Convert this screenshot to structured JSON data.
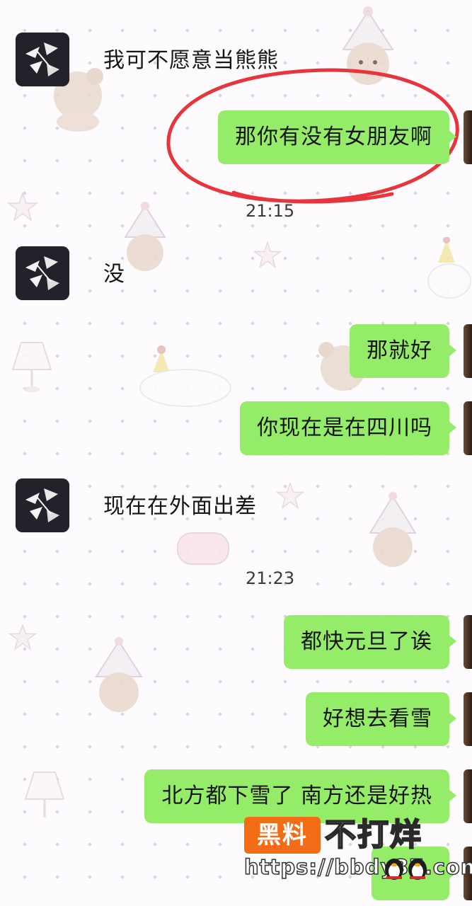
{
  "chat": {
    "messages": [
      {
        "side": "left",
        "text": "我可不愿意当熊熊"
      },
      {
        "side": "right",
        "text": "那你有没有女朋友啊",
        "highlighted": true
      },
      {
        "side": "left",
        "text": "没"
      },
      {
        "side": "right",
        "text": "那就好"
      },
      {
        "side": "right",
        "text": "你现在是在四川吗"
      },
      {
        "side": "left",
        "text": "现在在外面出差"
      },
      {
        "side": "right",
        "text": "都快元旦了诶"
      },
      {
        "side": "right",
        "text": "好想去看雪"
      },
      {
        "side": "right",
        "text": "北方都下雪了 南方还是好热"
      }
    ],
    "timestamps": [
      "21:15",
      "21:23"
    ],
    "colors": {
      "bubble_self": "#95ec69",
      "highlight_ring": "#e8343b"
    }
  },
  "watermark": {
    "badge": "黑料",
    "title": "不打烊",
    "url": "https://bbdy37.com"
  }
}
